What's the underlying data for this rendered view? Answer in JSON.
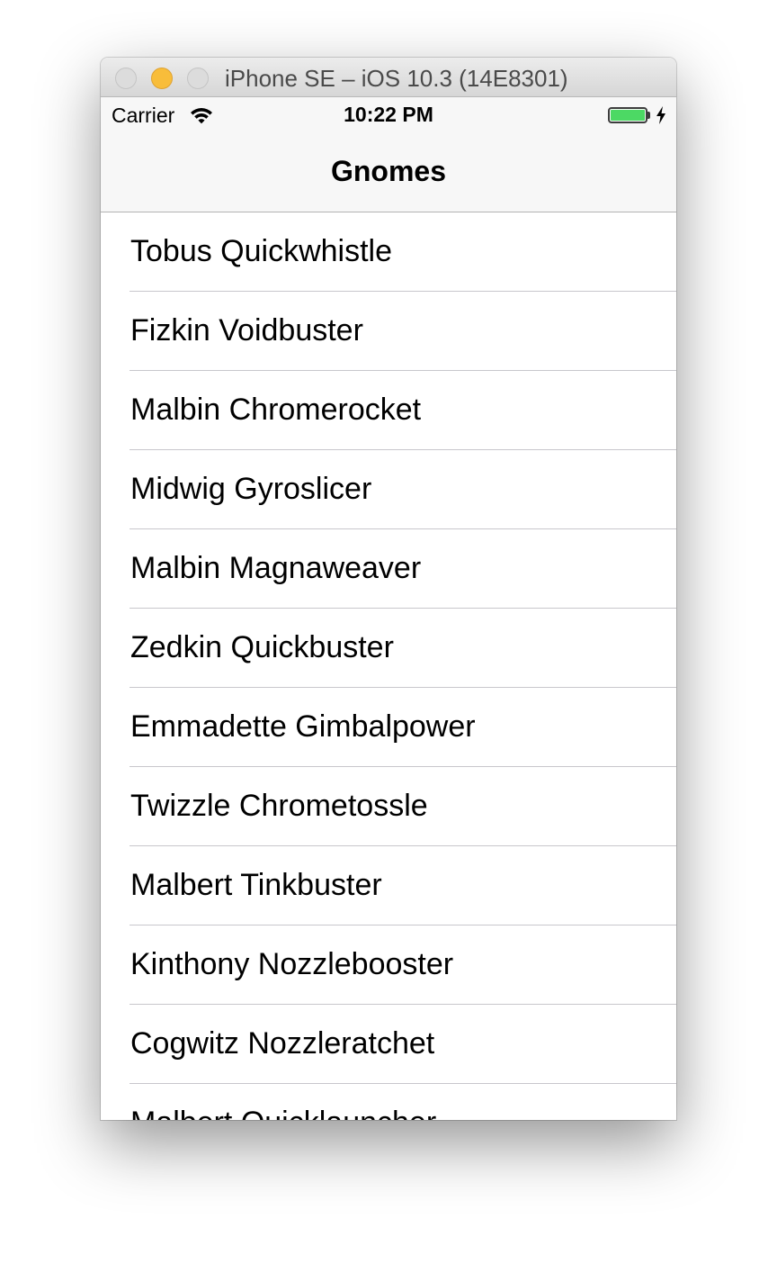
{
  "window": {
    "title": "iPhone SE – iOS 10.3 (14E8301)"
  },
  "status_bar": {
    "carrier": "Carrier",
    "time": "10:22 PM",
    "battery_color": "#4cd964"
  },
  "nav": {
    "title": "Gnomes"
  },
  "gnomes": [
    "Tobus Quickwhistle",
    "Fizkin Voidbuster",
    "Malbin Chromerocket",
    "Midwig Gyroslicer",
    "Malbin Magnaweaver",
    "Zedkin Quickbuster",
    "Emmadette Gimbalpower",
    "Twizzle Chrometossle",
    "Malbert Tinkbuster",
    "Kinthony Nozzlebooster",
    "Cogwitz Nozzleratchet",
    "Malbert Quicklauncher"
  ]
}
